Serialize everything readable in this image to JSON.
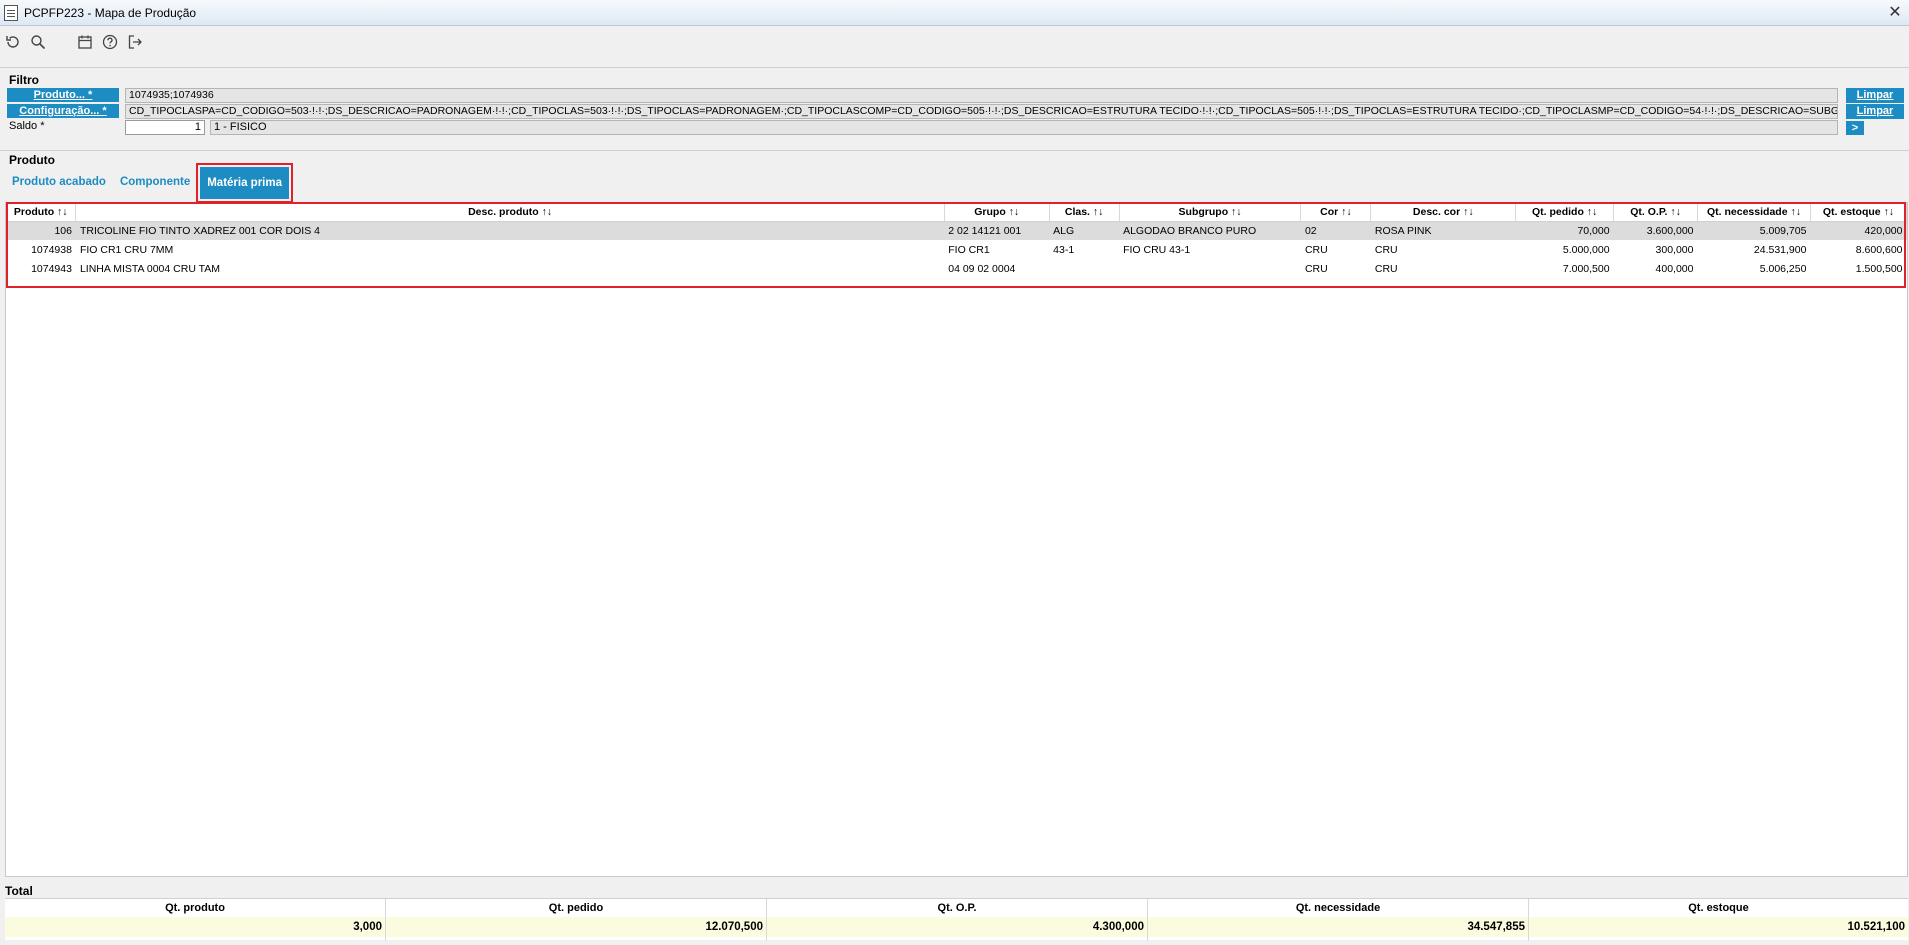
{
  "window": {
    "title": "PCPFP223 - Mapa de Produção",
    "close_glyph": "✕"
  },
  "toolbar": {
    "icons": [
      "refresh-icon",
      "search-icon",
      "calendar-icon",
      "help-icon",
      "exit-icon"
    ]
  },
  "filter": {
    "title": "Filtro",
    "produto_label": "Produto... *",
    "produto_value": "1074935;1074936",
    "config_label": "Configuração... *",
    "config_value": "CD_TIPOCLASPA=CD_CODIGO=503·!·!·;DS_DESCRICAO=PADRONAGEM·!·!·;CD_TIPOCLAS=503·!·!·;DS_TIPOCLAS=PADRONAGEM·;CD_TIPOCLASCOMP=CD_CODIGO=505·!·!·;DS_DESCRICAO=ESTRUTURA TECIDO·!·!·;CD_TIPOCLAS=505·!·!·;DS_TIPOCLAS=ESTRUTURA TECIDO·;CD_TIPOCLASMP=CD_CODIGO=54·!·!·;DS_DESCRICAO=SUBGRUPO·!·!·;CD_",
    "saldo_label": "Saldo *",
    "saldo_value": "1",
    "saldo_desc": "1 - FISICO",
    "limpar_label": "Limpar",
    "next_label": ">"
  },
  "produto": {
    "title": "Produto",
    "tabs": [
      {
        "label": "Produto acabado"
      },
      {
        "label": "Componente"
      },
      {
        "label": "Matéria prima"
      }
    ]
  },
  "grid": {
    "columns": [
      "Produto ↑↓",
      "Desc. produto ↑↓",
      "Grupo ↑↓",
      "Clas. ↑↓",
      "Subgrupo ↑↓",
      "Cor ↑↓",
      "Desc. cor ↑↓",
      "Qt. pedido ↑↓",
      "Qt. O.P. ↑↓",
      "Qt. necessidade ↑↓",
      "Qt. estoque ↑↓"
    ],
    "rows": [
      [
        "106",
        "TRICOLINE FIO TINTO XADREZ 001 COR DOIS 4",
        "2 02 14121 001",
        "ALG",
        "ALGODAO BRANCO PURO",
        "02",
        "ROSA PINK",
        "70,000",
        "3.600,000",
        "5.009,705",
        "420,000"
      ],
      [
        "1074938",
        "FIO CR1 CRU 7MM",
        "FIO CR1",
        "43-1",
        "FIO CRU 43-1",
        "CRU",
        "CRU",
        "5.000,000",
        "300,000",
        "24.531,900",
        "8.600,600"
      ],
      [
        "1074943",
        "LINHA MISTA 0004 CRU TAM",
        "04 09 02 0004",
        "",
        "",
        "CRU",
        "CRU",
        "7.000,500",
        "400,000",
        "5.006,250",
        "1.500,500"
      ]
    ]
  },
  "totals": {
    "title": "Total",
    "columns": [
      {
        "label": "Qt. produto",
        "value": "3,000"
      },
      {
        "label": "Qt. pedido",
        "value": "12.070,500"
      },
      {
        "label": "Qt. O.P.",
        "value": "4.300,000"
      },
      {
        "label": "Qt. necessidade",
        "value": "34.547,855"
      },
      {
        "label": "Qt. estoque",
        "value": "10.521,100"
      }
    ]
  }
}
